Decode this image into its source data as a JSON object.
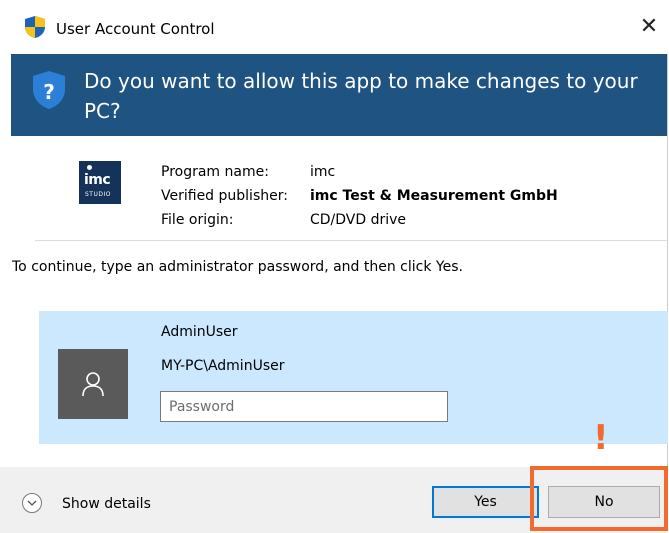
{
  "window": {
    "title": "User Account Control",
    "close_glyph": "✕"
  },
  "banner": {
    "question_glyph": "?",
    "text": "Do you want to allow this app to make changes to your PC?",
    "color": "#1f5482"
  },
  "program": {
    "logo_word": "imc",
    "logo_sub": "STUDIO",
    "name_label": "Program name:",
    "name_value": "imc",
    "publisher_label": "Verified publisher:",
    "publisher_value": "imc Test & Measurement GmbH",
    "origin_label": "File origin:",
    "origin_value": "CD/DVD drive"
  },
  "instructions": "To continue, type an administrator password, and then click Yes.",
  "credential": {
    "user": "AdminUser",
    "account": "MY-PC\\AdminUser",
    "password_placeholder": "Password",
    "avatar_icon": "user-icon"
  },
  "footer": {
    "show_details": "Show details",
    "yes_label": "Yes",
    "no_label": "No"
  },
  "annotation": {
    "mark": "!",
    "color": "#f26a2e"
  }
}
